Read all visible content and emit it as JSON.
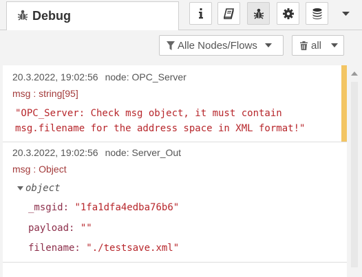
{
  "panel": {
    "title": "Debug"
  },
  "toolbar": {
    "filter_nodes_label": "Alle Nodes/Flows",
    "clear_label": "all"
  },
  "messages": [
    {
      "timestamp": "20.3.2022, 19:02:56",
      "node": "node: OPC_Server",
      "topic": "msg : string[95]",
      "line1": "\"OPC_Server: Check msg object, it must contain",
      "line2": "msg.filename for the address space in XML format!\""
    },
    {
      "timestamp": "20.3.2022, 19:02:56",
      "node": "node: Server_Out",
      "topic": "msg : Object",
      "object_label": "object",
      "props": [
        {
          "key": "_msgid:",
          "value": "\"1fa1dfa4edba76b6\""
        },
        {
          "key": "payload:",
          "value": "\"\""
        },
        {
          "key": "filename:",
          "value": "\"./testsave.xml\""
        }
      ]
    }
  ],
  "colors": {
    "accent_warning": "#f3c563",
    "string_value": "#b7262b",
    "property_key": "#8c2e4a",
    "topic_text": "#a33a3a"
  },
  "icons": [
    "bug-icon",
    "info-icon",
    "book-icon",
    "gear-icon",
    "database-icon",
    "chevron-down-icon",
    "filter-icon",
    "trash-icon",
    "scroll-up-icon"
  ]
}
